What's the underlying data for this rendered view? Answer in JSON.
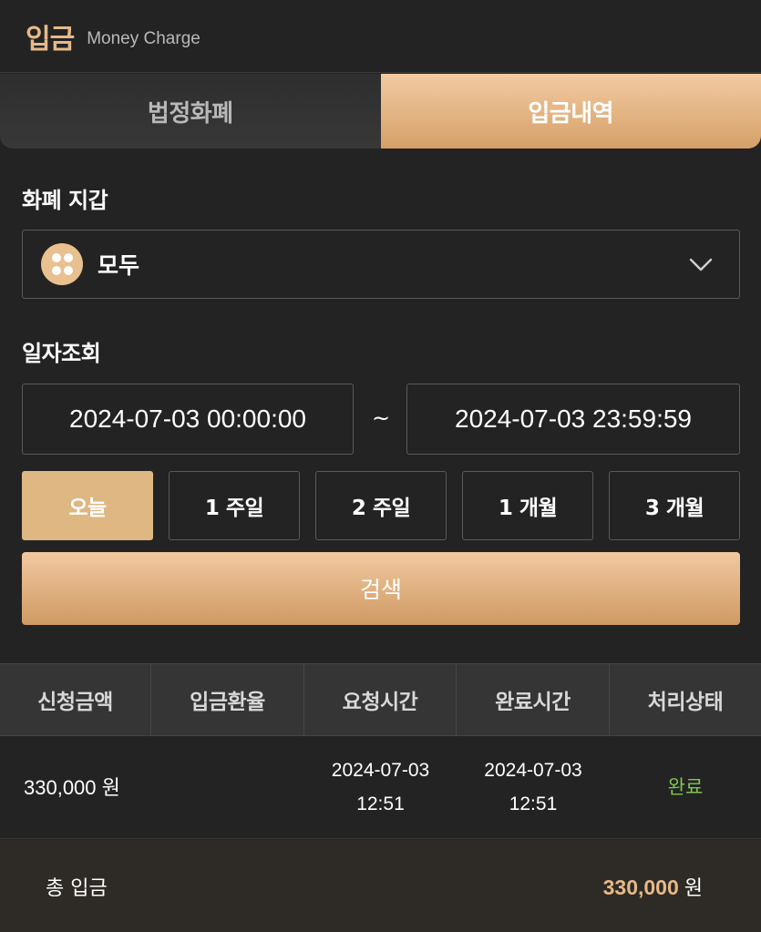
{
  "header": {
    "title": "입금",
    "subtitle": "Money Charge"
  },
  "tabs": [
    {
      "label": "법정화폐",
      "active": false
    },
    {
      "label": "입금내역",
      "active": true
    }
  ],
  "wallet": {
    "label": "화폐 지갑",
    "selected": "모두",
    "icon": "coin-grid-icon"
  },
  "date_query": {
    "label": "일자조회",
    "start": "2024-07-03 00:00:00",
    "separator": "~",
    "end": "2024-07-03 23:59:59"
  },
  "periods": [
    {
      "label": "오늘",
      "active": true
    },
    {
      "label": "1 주일",
      "active": false
    },
    {
      "label": "2 주일",
      "active": false
    },
    {
      "label": "1 개월",
      "active": false
    },
    {
      "label": "3 개월",
      "active": false
    }
  ],
  "search": {
    "label": "검색"
  },
  "table": {
    "headers": [
      "신청금액",
      "입금환율",
      "요청시간",
      "완료시간",
      "처리상태"
    ],
    "rows": [
      {
        "amount": "330,000 원",
        "rate": "",
        "request_date": "2024-07-03",
        "request_time": "12:51",
        "complete_date": "2024-07-03",
        "complete_time": "12:51",
        "status": "완료"
      }
    ]
  },
  "total": {
    "label": "총 입금",
    "amount": "330,000",
    "unit": "원"
  },
  "colors": {
    "accent": "#e6b98a",
    "active_tab": "#deb783",
    "status_done": "#7ec650",
    "background": "#232323"
  }
}
